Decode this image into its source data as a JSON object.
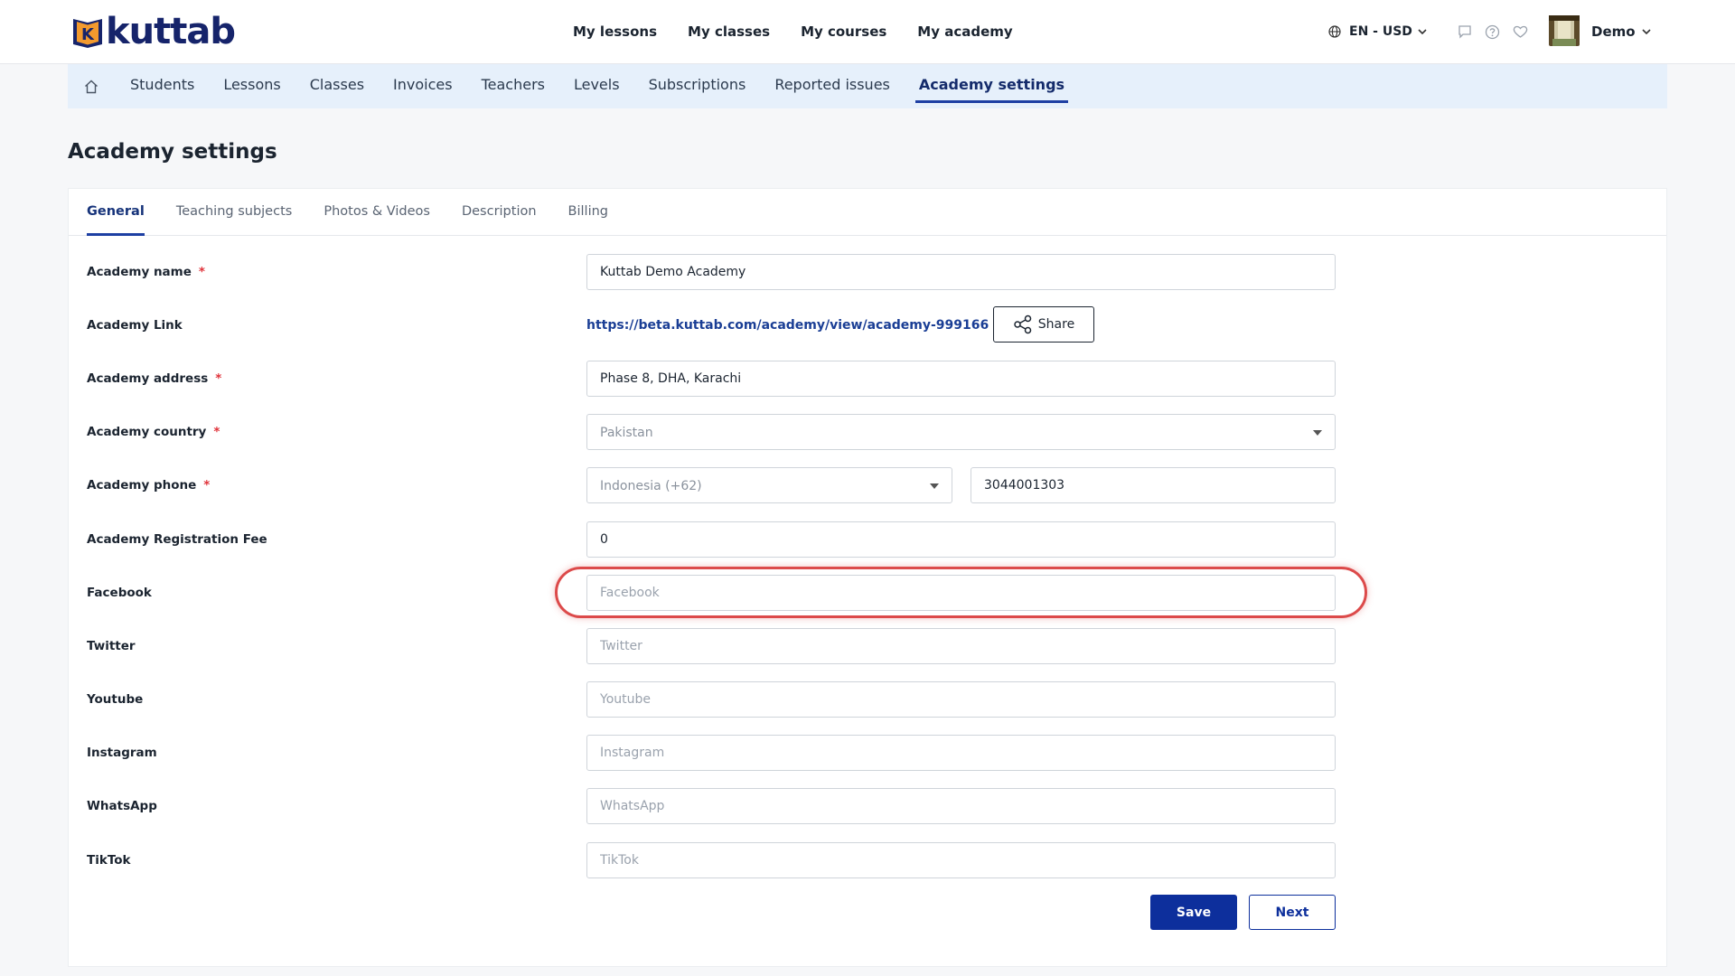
{
  "brand": {
    "logo_text": "kuttab",
    "logo_letter": "K"
  },
  "main_nav": [
    "My lessons",
    "My classes",
    "My courses",
    "My academy"
  ],
  "header": {
    "lang_currency": "EN - USD",
    "user_name": "Demo"
  },
  "sub_nav": {
    "items": [
      "Students",
      "Lessons",
      "Classes",
      "Invoices",
      "Teachers",
      "Levels",
      "Subscriptions",
      "Reported issues",
      "Academy settings"
    ],
    "active": "Academy settings"
  },
  "page_title": "Academy settings",
  "tabs": {
    "items": [
      "General",
      "Teaching subjects",
      "Photos & Videos",
      "Description",
      "Billing"
    ],
    "active": "General"
  },
  "form": {
    "academy_name": {
      "label": "Academy name",
      "value": "Kuttab Demo Academy",
      "required": "*"
    },
    "academy_link": {
      "label": "Academy Link",
      "url": "https://beta.kuttab.com/academy/view/academy-999166",
      "share_label": "Share"
    },
    "academy_address": {
      "label": "Academy address",
      "value": "Phase 8, DHA, Karachi",
      "required": "*"
    },
    "academy_country": {
      "label": "Academy country",
      "value": "Pakistan",
      "required": "*"
    },
    "academy_phone": {
      "label": "Academy phone",
      "country_code": "Indonesia (+62)",
      "number": "3044001303",
      "required": "*"
    },
    "registration_fee": {
      "label": "Academy Registration Fee",
      "value": "0"
    },
    "facebook": {
      "label": "Facebook",
      "placeholder": "Facebook"
    },
    "twitter": {
      "label": "Twitter",
      "placeholder": "Twitter"
    },
    "youtube": {
      "label": "Youtube",
      "placeholder": "Youtube"
    },
    "instagram": {
      "label": "Instagram",
      "placeholder": "Instagram"
    },
    "whatsapp": {
      "label": "WhatsApp",
      "placeholder": "WhatsApp"
    },
    "tiktok": {
      "label": "TikTok",
      "placeholder": "TikTok"
    }
  },
  "actions": {
    "save": "Save",
    "next": "Next"
  },
  "colors": {
    "primary": "#0d2f9c",
    "highlight": "#dc4a4a",
    "subnav_bg": "#e6f0fb",
    "required": "#e0323a"
  }
}
